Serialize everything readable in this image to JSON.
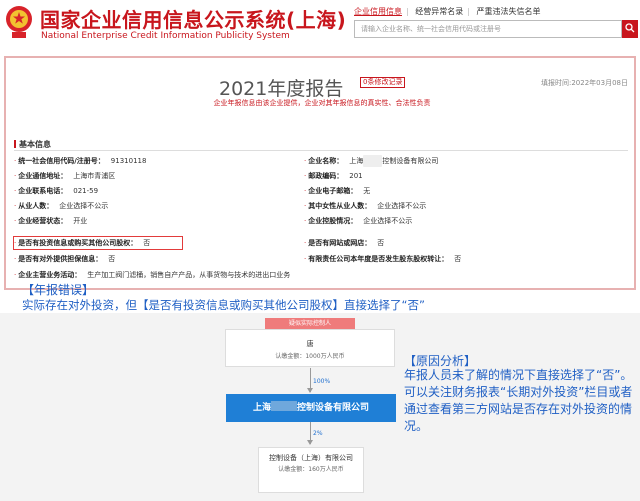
{
  "header": {
    "title": "国家企业信用信息公示系统(上海)",
    "subtitle": "National Enterprise Credit Information Publicity System",
    "links": [
      "企业信用信息",
      "经营异常名录",
      "严重违法失信名单"
    ],
    "search_placeholder": "请输入企业名称、统一社会信用代码或注册号"
  },
  "report": {
    "title": "2021年度报告",
    "revision_badge": "0条修改记录",
    "fill_date": "填报时间:2022年03月08日",
    "notice": "企业年报信息由该企业提供，企业对其年报信息的真实性、合法性负责",
    "section_title": "基本信息",
    "left_fields": [
      {
        "label": "统一社会信用代码/注册号：",
        "value": "91310118"
      },
      {
        "label": "企业通信地址：",
        "value": "上海市青浦区"
      },
      {
        "label": "企业联系电话：",
        "value": "021-59"
      },
      {
        "label": "从业人数：",
        "value": "企业选择不公示"
      },
      {
        "label": "企业经营状态：",
        "value": "开业"
      },
      {
        "label": "是否有投资信息或购买其他公司股权：",
        "value": "否"
      },
      {
        "label": "是否有对外提供担保信息：",
        "value": "否"
      },
      {
        "label": "企业主营业务活动：",
        "value": "生产加工阀门滤桶，销售自产产品，从事货物与技术的进出口业务"
      }
    ],
    "right_fields": [
      {
        "label": "企业名称：",
        "value": "上海",
        "value2": "控制设备有限公司"
      },
      {
        "label": "邮政编码：",
        "value": "201"
      },
      {
        "label": "企业电子邮箱：",
        "value": "无"
      },
      {
        "label": "其中女性从业人数：",
        "value": "企业选择不公示"
      },
      {
        "label": "企业控股情况：",
        "value": "企业选择不公示"
      },
      {
        "label": "是否有网站或网店：",
        "value": "否"
      },
      {
        "label": "有限责任公司本年度是否发生股东股权转让：",
        "value": "否"
      }
    ]
  },
  "annotation_error": {
    "title": "【年报错误】",
    "text": "实际存在对外投资，但【是否有投资信息或购买其他公司股权】直接选择了“否”"
  },
  "equity_chart": {
    "tag": "疑似实际控制人",
    "top": {
      "name": "唐",
      "capital": "认缴金额：1000万人民币"
    },
    "pct1": "100%",
    "middle": {
      "prefix": "上海",
      "suffix": "控制设备有限公司"
    },
    "pct2": "2%",
    "bottom": {
      "name": "控制设备（上海）有限公司",
      "capital": "认缴金额：160万人民币"
    }
  },
  "annotation_cause": {
    "title": "【原因分析】",
    "text": "年报人员未了解的情况下直接选择了“否”。可以关注财务报表“长期对外投资”栏目或者通过查看第三方网站是否存在对外投资的情况。"
  },
  "colors": {
    "brand": "#c8161d",
    "note_blue": "#1f5fc4",
    "chart_blue": "#1f7fd6"
  }
}
